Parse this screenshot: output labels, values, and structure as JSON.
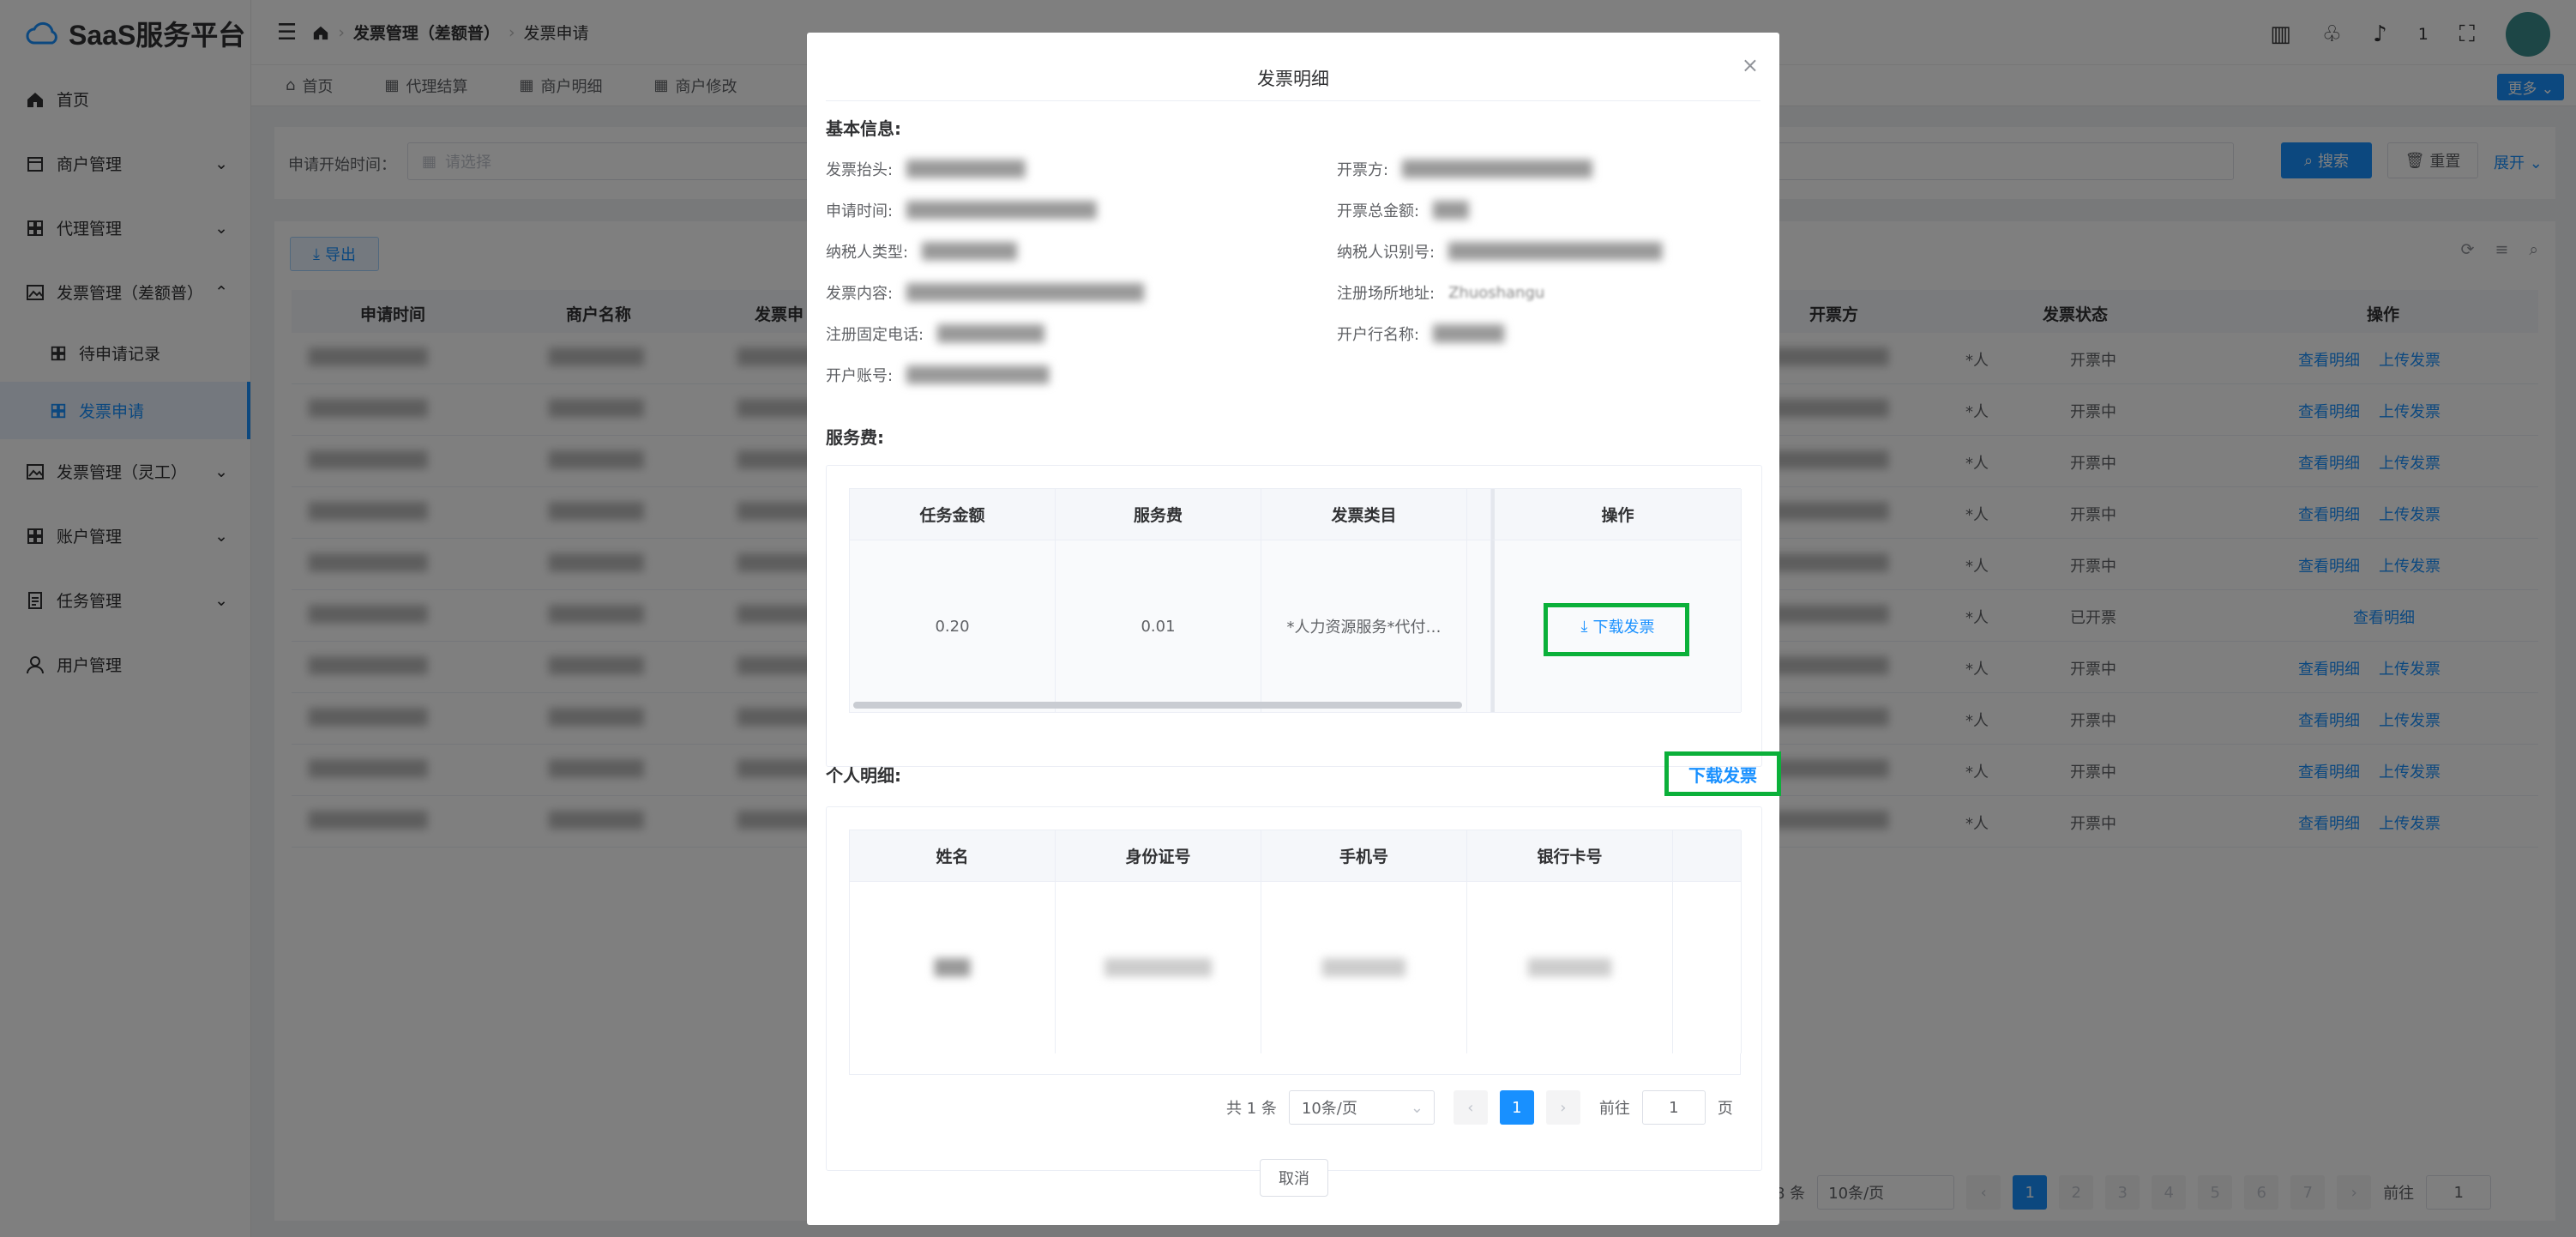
{
  "app": {
    "title": "SaaS服务平台"
  },
  "sidebar": {
    "items": [
      {
        "label": "首页"
      },
      {
        "label": "商户管理"
      },
      {
        "label": "代理管理"
      },
      {
        "label": "发票管理（差额普）"
      },
      {
        "label": "待申请记录"
      },
      {
        "label": "发票申请"
      },
      {
        "label": "发票管理（灵工）"
      },
      {
        "label": "账户管理"
      },
      {
        "label": "任务管理"
      },
      {
        "label": "用户管理"
      }
    ]
  },
  "header": {
    "breadcrumb": [
      "发票管理（差额普）",
      "发票申请"
    ],
    "badge": "1"
  },
  "tabs": [
    "首页",
    "代理结算",
    "商户明细",
    "商户修改"
  ],
  "more_label": "更多",
  "search": {
    "label": "申请开始时间：",
    "placeholder": "请选择",
    "search_btn": "搜索",
    "reset_btn": "重置",
    "expand": "展开"
  },
  "toolbar": {
    "export_label": "导出"
  },
  "bg_table": {
    "headers": [
      "申请时间",
      "商户名称",
      "发票申",
      "开票方",
      "发票状态",
      "操作"
    ],
    "rows": [
      {
        "status": "开票中",
        "ops": [
          "查看明细",
          "上传发票"
        ]
      },
      {
        "status": "开票中",
        "ops": [
          "查看明细",
          "上传发票"
        ]
      },
      {
        "status": "开票中",
        "ops": [
          "查看明细",
          "上传发票"
        ]
      },
      {
        "status": "开票中",
        "ops": [
          "查看明细",
          "上传发票"
        ]
      },
      {
        "status": "开票中",
        "ops": [
          "查看明细",
          "上传发票"
        ]
      },
      {
        "status": "已开票",
        "ops": [
          "查看明细"
        ]
      },
      {
        "status": "开票中",
        "ops": [
          "查看明细",
          "上传发票"
        ]
      },
      {
        "status": "开票中",
        "ops": [
          "查看明细",
          "上传发票"
        ]
      },
      {
        "status": "开票中",
        "ops": [
          "查看明细",
          "上传发票"
        ]
      },
      {
        "status": "开票中",
        "ops": [
          "查看明细",
          "上传发票"
        ]
      }
    ],
    "row_prefix": "*人",
    "pager": {
      "total": "8 条",
      "size": "10条/页",
      "pages": [
        "1",
        "2",
        "3",
        "4",
        "5",
        "6",
        "7"
      ],
      "goto": "前往",
      "page_value": "1"
    }
  },
  "modal": {
    "title": "发票明细",
    "basic_title": "基本信息:",
    "basic_fields": [
      {
        "label": "发票抬头:"
      },
      {
        "label": "开票方:"
      },
      {
        "label": "申请时间:"
      },
      {
        "label": "开票总金额:"
      },
      {
        "label": "纳税人类型:"
      },
      {
        "label": "纳税人识别号:"
      },
      {
        "label": "发票内容:"
      },
      {
        "label": "注册场所地址:",
        "value": "Zhuoshangu"
      },
      {
        "label": "注册固定电话:"
      },
      {
        "label": "开户行名称:"
      },
      {
        "label": "开户账号:"
      }
    ],
    "service_title": "服务费:",
    "service_table": {
      "headers": [
        "任务金额",
        "服务费",
        "发票类目",
        "操作"
      ],
      "row": {
        "amount": "0.20",
        "fee": "0.01",
        "category": "*人力资源服务*代付…",
        "action": "下载发票"
      }
    },
    "personal_title": "个人明细:",
    "personal_download": "下载发票",
    "personal_table": {
      "headers": [
        "姓名",
        "身份证号",
        "手机号",
        "银行卡号"
      ]
    },
    "pager": {
      "total": "共 1 条",
      "size": "10条/页",
      "page": "1",
      "goto": "前往",
      "goto_value": "1",
      "unit": "页"
    },
    "cancel": "取消"
  }
}
